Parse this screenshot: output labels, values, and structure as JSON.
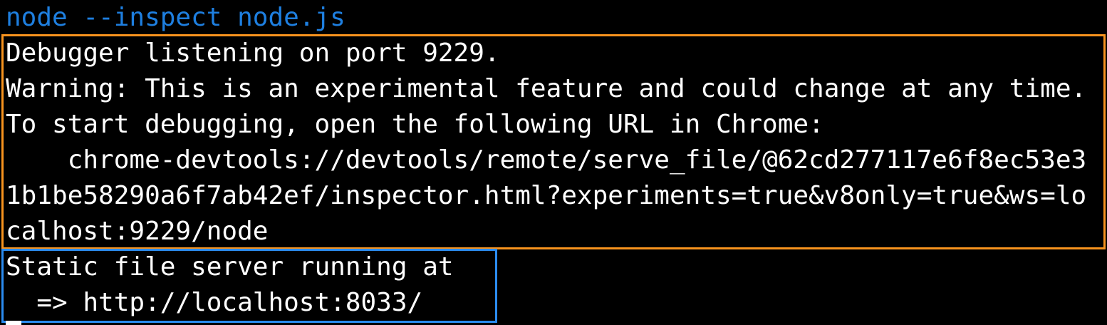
{
  "terminal": {
    "command": "node --inspect node.js",
    "debugger_output": [
      "Debugger listening on port 9229.",
      "Warning: This is an experimental feature and could change at any time.",
      "To start debugging, open the following URL in Chrome:",
      "    chrome-devtools://devtools/remote/serve_file/@62cd277117e6f8ec53e3",
      "1b1be58290a6f7ab42ef/inspector.html?experiments=true&v8only=true&ws=lo",
      "calhost:9229/node"
    ],
    "server_output": [
      "Static file server running at",
      "  => http://localhost:8033/"
    ]
  },
  "colors": {
    "background": "#000000",
    "text": "#ffffff",
    "command": "#1e7fe0",
    "debugger_highlight": "#f7931e",
    "server_highlight": "#2b8cf0"
  }
}
